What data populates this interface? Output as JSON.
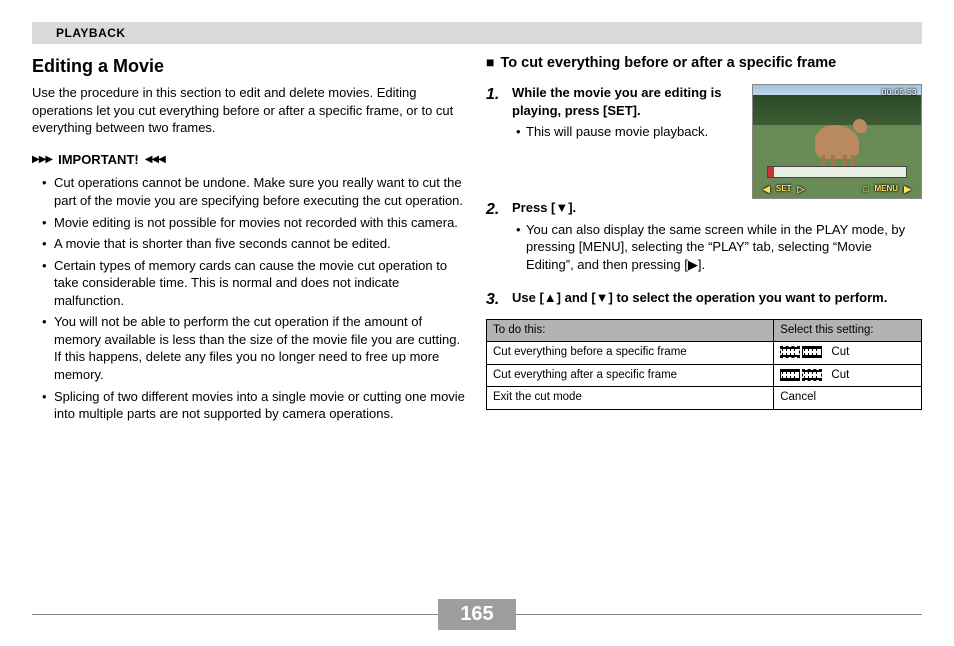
{
  "header": {
    "chapter": "PLAYBACK"
  },
  "left": {
    "title": "Editing a Movie",
    "intro": "Use the procedure in this section to edit and delete movies. Editing operations let you cut everything before or after a specific frame, or to cut everything between two frames.",
    "important_label": "IMPORTANT!",
    "bullets": [
      "Cut operations cannot be undone. Make sure you really want to cut the part of the movie you are specifying before executing the cut operation.",
      "Movie editing is not possible for movies not recorded with this camera.",
      "A movie that is shorter than five seconds cannot be edited.",
      "Certain types of memory cards can cause the movie cut operation to take considerable time. This is normal and does not indicate malfunction.",
      "You will not be able to perform the cut operation if the amount of memory available is less than the size of the movie file you are cutting. If this happens, delete any files you no longer need to free up more memory.",
      "Splicing of two different movies into a single movie or cutting one movie into multiple parts are not supported by camera operations."
    ]
  },
  "right": {
    "subhead": "To cut everything before or after a specific frame",
    "screenshot": {
      "timecode": "00:05:53",
      "btn_left_label": "SET",
      "btn_right_label": "MENU"
    },
    "steps": [
      {
        "num": "1.",
        "title": "While the movie you are editing is playing, press [SET].",
        "bullets": [
          "This will pause movie playback."
        ]
      },
      {
        "num": "2.",
        "title": "Press [▼].",
        "bullets": [
          "You can also display the same screen while in the PLAY mode, by pressing [MENU], selecting the “PLAY” tab, selecting “Movie Editing”, and then pressing [▶]."
        ]
      },
      {
        "num": "3.",
        "title": "Use [▲] and [▼] to select the operation you want to perform.",
        "bullets": []
      }
    ],
    "table": {
      "head_left": "To do this:",
      "head_right": "Select this setting:",
      "rows": [
        {
          "desc": "Cut everything before a specific frame",
          "setting_suffix": " Cut",
          "icon": "before"
        },
        {
          "desc": "Cut everything after a specific frame",
          "setting_suffix": " Cut",
          "icon": "after"
        },
        {
          "desc": "Exit the cut mode",
          "setting_suffix": "Cancel",
          "icon": ""
        }
      ]
    }
  },
  "page_number": "165"
}
